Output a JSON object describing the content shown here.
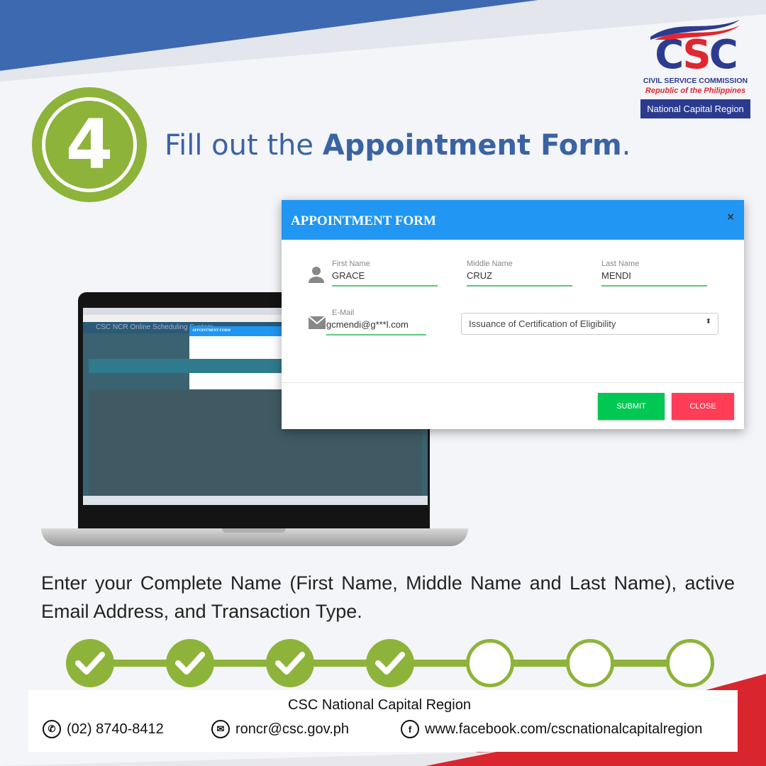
{
  "step": {
    "number": "4",
    "headline_prefix": "Fill out the ",
    "headline_bold": "Appointment Form",
    "headline_suffix": "."
  },
  "logo": {
    "text": "CSC",
    "line1": "CIVIL SERVICE COMMISSION",
    "line2": "Republic of the Philippines",
    "region": "National Capital Region"
  },
  "laptop_screen": {
    "app_title": "CSC NCR Online Scheduling System",
    "modal_title": "APPOINTMENT FORM"
  },
  "form": {
    "title": "APPOINTMENT FORM",
    "close_icon": "×",
    "first_name": {
      "label": "First Name",
      "value": "GRACE"
    },
    "middle_name": {
      "label": "Middle Name",
      "value": "CRUZ"
    },
    "last_name": {
      "label": "Last Name",
      "value": "MENDI"
    },
    "email": {
      "label": "E-Mail",
      "value": "gcmendi@g***l.com"
    },
    "transaction": {
      "selected": "Issuance of Certification of Eligibility"
    },
    "submit_label": "SUBMIT",
    "close_label": "CLOSE",
    "colors": {
      "header": "#2196f3",
      "submit": "#00c853",
      "close": "#ff3d57"
    }
  },
  "description": "Enter your Complete Name (First Name, Middle Name and Last Name), active Email Address, and Transaction Type.",
  "progress": {
    "total_steps": 7,
    "completed_steps": 4,
    "color": "#8db33a"
  },
  "footer": {
    "title": "CSC National Capital Region",
    "phone": "(02) 8740-8412",
    "email": "roncr@csc.gov.ph",
    "facebook": "www.facebook.com/cscnationalcapitalregion"
  }
}
